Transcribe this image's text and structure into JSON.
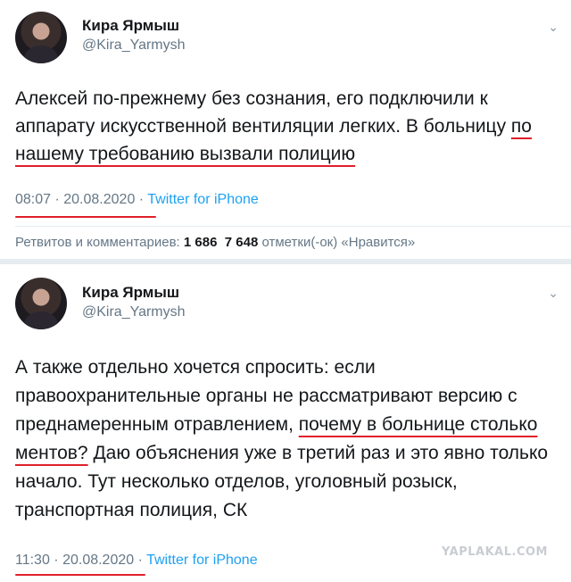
{
  "tweets": [
    {
      "author_name": "Кира Ярмыш",
      "handle": "@Kira_Yarmysh",
      "text_part1": "Алексей по-прежнему без сознания, его подключили к аппарату искусственной вентиляции легких. В больницу ",
      "text_underlined": "по нашему требованию вызвали полицию",
      "time_date": "08:07 · 20.08.2020",
      "separator": " · ",
      "source": "Twitter for iPhone",
      "stats_label": "Ретвитов и комментариев:",
      "retweets": "1 686",
      "likes": "7 648",
      "likes_label": "отметки(-ок) «Нравится»"
    },
    {
      "author_name": "Кира Ярмыш",
      "handle": "@Kira_Yarmysh",
      "text_part1": "А также отдельно хочется спросить: если правоохранительные органы не рассматривают версию с преднамеренным отравлением, ",
      "text_underlined": "почему в больнице столько ментов?",
      "text_part2": " Даю объяснения уже в третий раз и это явно только начало. Тут несколько отделов, уголовный розыск, транспортная полиция, СК",
      "time_date": "11:30 · 20.08.2020",
      "separator": " · ",
      "source": "Twitter for iPhone"
    }
  ],
  "watermark": "YAPLAKAL.COM",
  "icons": {
    "more": "chevron-down-icon",
    "underline_color": "#e0202a"
  }
}
